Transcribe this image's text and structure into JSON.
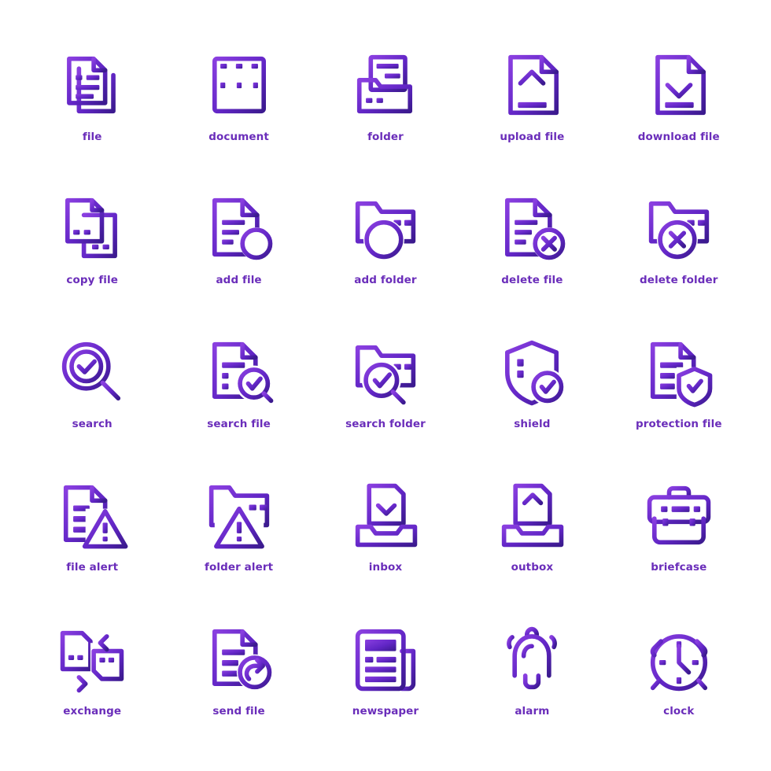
{
  "sheet": {
    "title": "File and Document Icon Set",
    "background_color": "#ffffff",
    "label_color": "#6A2DBA",
    "gradient_start": "#8A3FE0",
    "gradient_end": "#3B1A8E",
    "columns": 5,
    "rows": 5,
    "total_icons": 25,
    "style": "line / outline with gradient stroke"
  },
  "icons": [
    {
      "label": "file",
      "icon_name": "file-icon"
    },
    {
      "label": "document",
      "icon_name": "document-icon"
    },
    {
      "label": "folder",
      "icon_name": "folder-icon"
    },
    {
      "label": "upload file",
      "icon_name": "upload-file-icon"
    },
    {
      "label": "download file",
      "icon_name": "download-file-icon"
    },
    {
      "label": "copy file",
      "icon_name": "copy-file-icon"
    },
    {
      "label": "add file",
      "icon_name": "add-file-icon"
    },
    {
      "label": "add folder",
      "icon_name": "add-folder-icon"
    },
    {
      "label": "delete file",
      "icon_name": "delete-file-icon"
    },
    {
      "label": "delete folder",
      "icon_name": "delete-folder-icon"
    },
    {
      "label": "search",
      "icon_name": "search-icon"
    },
    {
      "label": "search file",
      "icon_name": "search-file-icon"
    },
    {
      "label": "search folder",
      "icon_name": "search-folder-icon"
    },
    {
      "label": "shield",
      "icon_name": "shield-icon"
    },
    {
      "label": "protection file",
      "icon_name": "protection-file-icon"
    },
    {
      "label": "file alert",
      "icon_name": "file-alert-icon"
    },
    {
      "label": "folder alert",
      "icon_name": "folder-alert-icon"
    },
    {
      "label": "inbox",
      "icon_name": "inbox-icon"
    },
    {
      "label": "outbox",
      "icon_name": "outbox-icon"
    },
    {
      "label": "briefcase",
      "icon_name": "briefcase-icon"
    },
    {
      "label": "exchange",
      "icon_name": "exchange-icon"
    },
    {
      "label": "send file",
      "icon_name": "send-file-icon"
    },
    {
      "label": "newspaper",
      "icon_name": "newspaper-icon"
    },
    {
      "label": "alarm",
      "icon_name": "alarm-icon"
    },
    {
      "label": "clock",
      "icon_name": "clock-icon"
    }
  ]
}
